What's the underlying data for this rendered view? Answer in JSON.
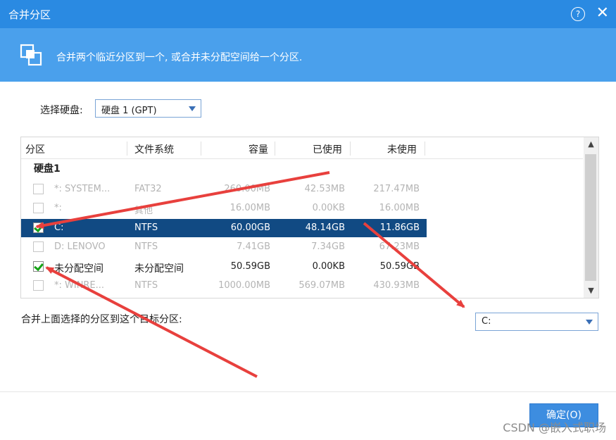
{
  "window": {
    "title": "合并分区",
    "help_icon": "?",
    "close_icon": "✕"
  },
  "banner": {
    "icon": "merge-partition-icon",
    "text": "合并两个临近分区到一个, 或合并未分配空间给一个分区."
  },
  "disk_select": {
    "label": "选择硬盘:",
    "value": "硬盘 1 (GPT)"
  },
  "table": {
    "columns": [
      "分区",
      "文件系统",
      "容量",
      "已使用",
      "未使用"
    ],
    "group": "硬盘1",
    "rows": [
      {
        "checked": false,
        "state": "disabled",
        "name": "*: SYSTEM...",
        "fs": "FAT32",
        "capacity": "260.00MB",
        "used": "42.53MB",
        "free": "217.47MB"
      },
      {
        "checked": false,
        "state": "disabled",
        "name": "*:",
        "fs": "其他",
        "capacity": "16.00MB",
        "used": "0.00KB",
        "free": "16.00MB"
      },
      {
        "checked": true,
        "state": "selected",
        "name": "C:",
        "fs": "NTFS",
        "capacity": "60.00GB",
        "used": "48.14GB",
        "free": "11.86GB"
      },
      {
        "checked": false,
        "state": "disabled",
        "name": "D: LENOVO",
        "fs": "NTFS",
        "capacity": "7.41GB",
        "used": "7.34GB",
        "free": "67.23MB"
      },
      {
        "checked": true,
        "state": "normal",
        "name": "未分配空间",
        "fs": "未分配空间",
        "capacity": "50.59GB",
        "used": "0.00KB",
        "free": "50.59GB"
      },
      {
        "checked": false,
        "state": "disabled",
        "name": "*: WINRE...",
        "fs": "NTFS",
        "capacity": "1000.00MB",
        "used": "569.07MB",
        "free": "430.93MB"
      }
    ]
  },
  "merge_target": {
    "label": "合并上面选择的分区到这个目标分区:",
    "value": "C:"
  },
  "footer": {
    "ok_label": "确定(O)"
  },
  "watermark": "CSDN @嵌入式职场",
  "colors": {
    "titlebar": "#2a8ae2",
    "banner": "#4aa0ec",
    "selected_row": "#114a83",
    "arrow": "#e8403d"
  }
}
